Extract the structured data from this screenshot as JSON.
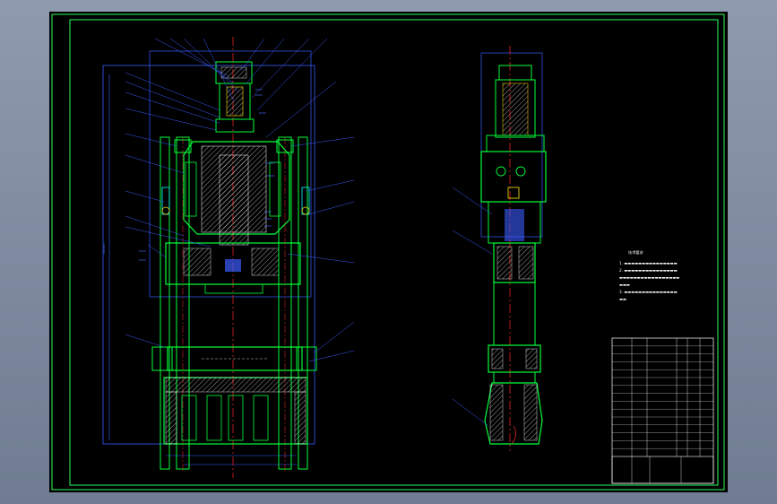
{
  "window": {
    "background_color": "#7f8ba0",
    "canvas_color": "#000000"
  },
  "drawing": {
    "type": "CAD assembly drawing",
    "technical_requirements_title": "技术要求",
    "technical_requirements": [
      "1.",
      "2.",
      "3."
    ],
    "title_block_rows": 15,
    "colors": {
      "border": "#2aff5a",
      "outline": "#00ff3a",
      "dimension": "#3a5cff",
      "centerline": "#ff2a2a",
      "hatch": "#ffffff",
      "cyan": "#00ffff",
      "yellow": "#ffe600"
    }
  }
}
